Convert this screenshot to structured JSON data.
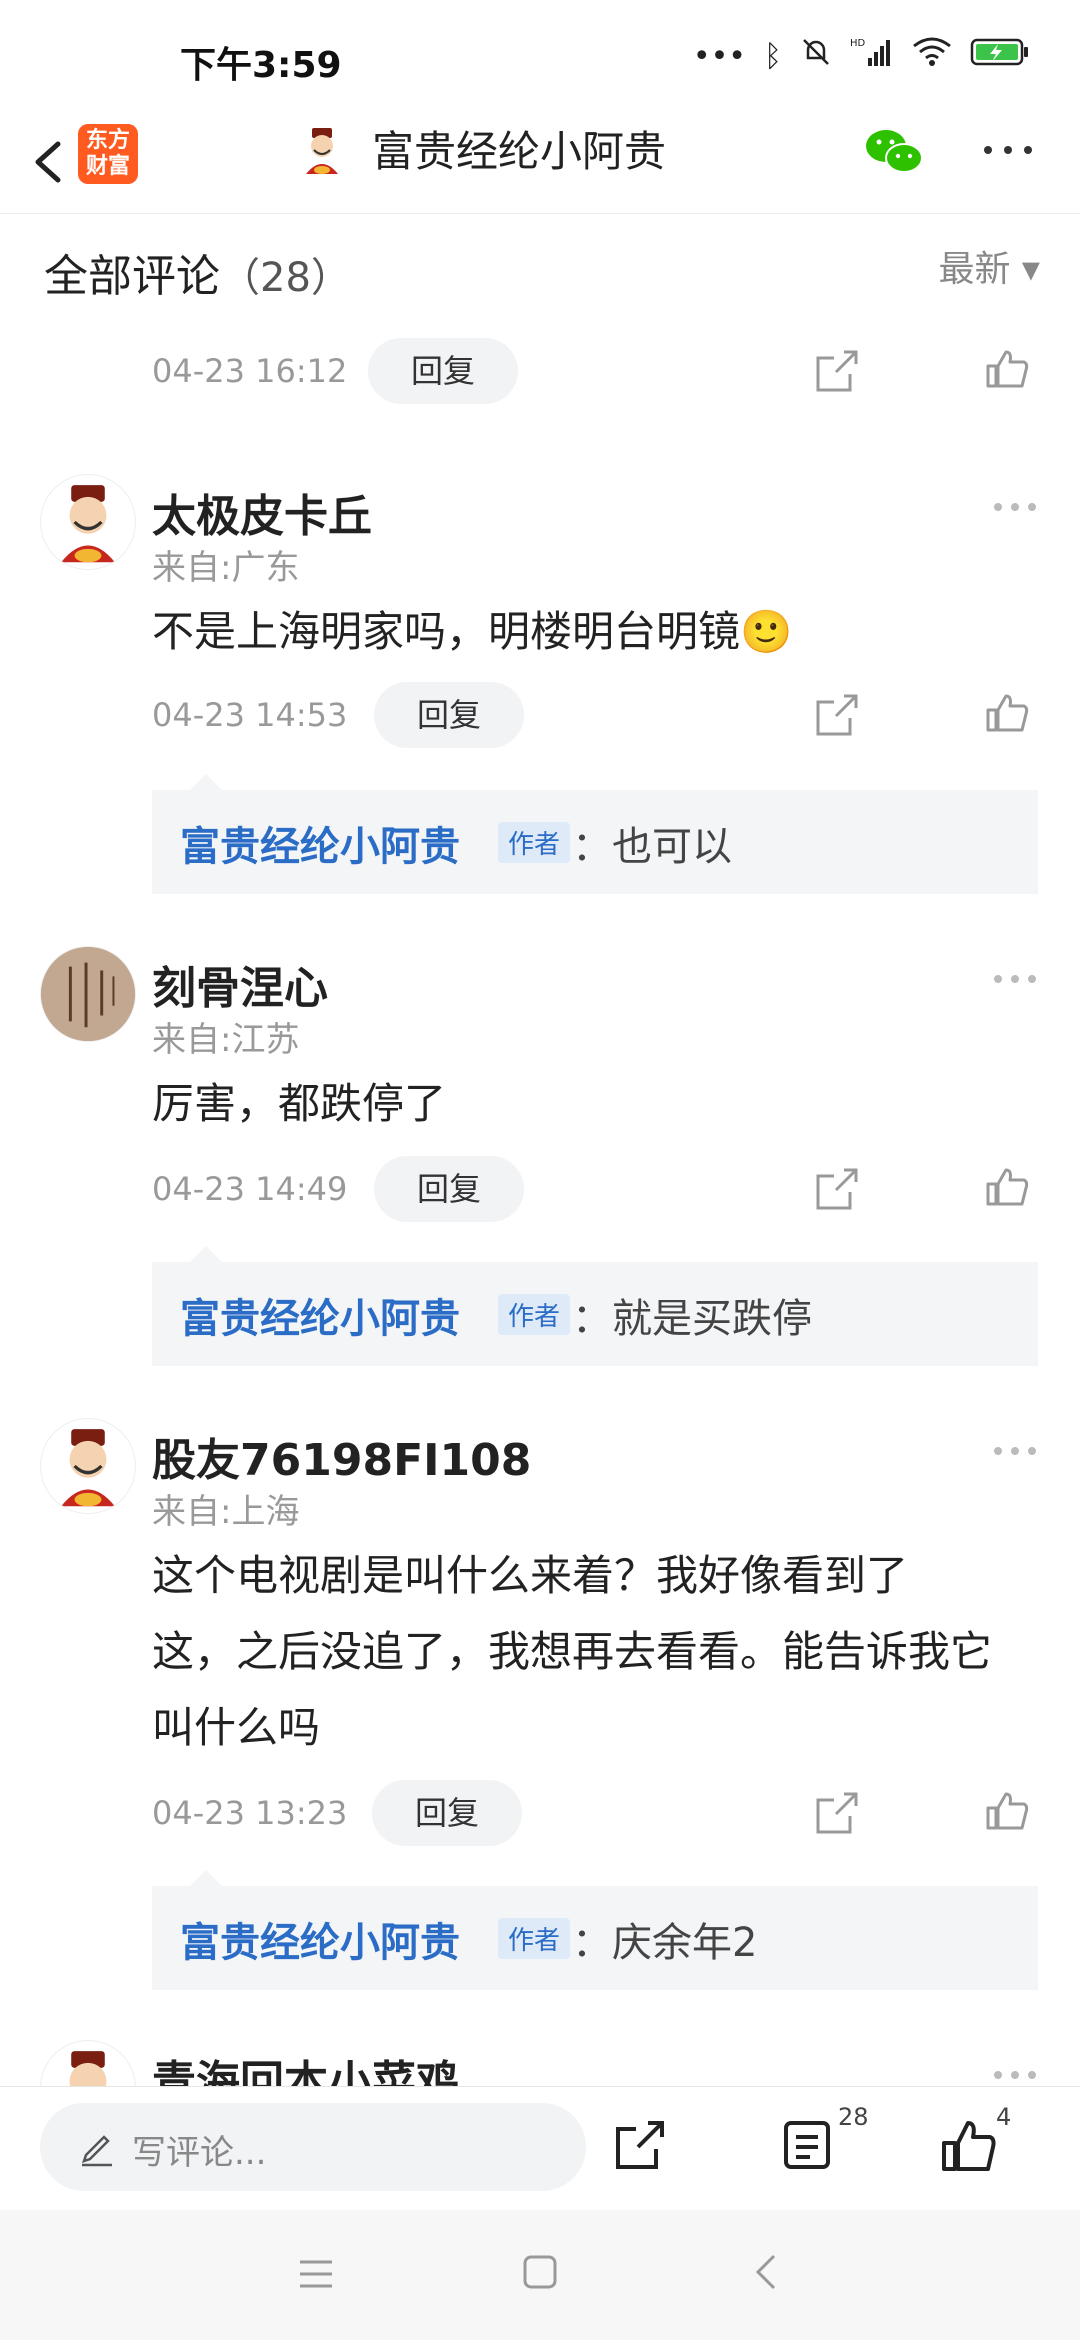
{
  "status_bar": {
    "time": "下午3:59",
    "icons": [
      "more-dots-icon",
      "bluetooth-icon",
      "mute-bell-icon",
      "hd-signal-icon",
      "wifi-icon",
      "battery-charging-icon"
    ]
  },
  "nav": {
    "logo_line1": "东方",
    "logo_line2": "财富",
    "title": "富贵经纶小阿贵"
  },
  "section": {
    "title": "全部评论",
    "count": "（28）",
    "sort_label": "最新 ▾"
  },
  "first_meta": {
    "time": "04-23 16:12",
    "reply": "回复"
  },
  "comments": [
    {
      "name": "太极皮卡丘",
      "location": "来自:广东",
      "text": "不是上海明家吗，明楼明台明镜🙂",
      "time": "04-23 14:53",
      "reply": "回复",
      "author_reply": {
        "author": "富贵经纶小阿贵",
        "badge": "作者",
        "text": "：也可以"
      }
    },
    {
      "name": "刻骨涅心",
      "location": "来自:江苏",
      "text": "厉害，都跌停了",
      "time": "04-23 14:49",
      "reply": "回复",
      "author_reply": {
        "author": "富贵经纶小阿贵",
        "badge": "作者",
        "text": "：就是买跌停"
      }
    },
    {
      "name": "股友76198FI108",
      "location": "来自:上海",
      "text_lines": [
        "这个电视剧是叫什么来着？我好像看到了",
        "这，之后没追了，我想再去看看。能告诉我它",
        "叫什么吗"
      ],
      "time": "04-23 13:23",
      "reply": "回复",
      "author_reply": {
        "author": "富贵经纶小阿贵",
        "badge": "作者",
        "text": "：庆余年2"
      }
    },
    {
      "name": "青海回本小菜鸡"
    }
  ],
  "bottom_bar": {
    "input_placeholder": "写评论...",
    "comment_count": "28",
    "like_count": "4"
  },
  "colors": {
    "accent_blue": "#2a6cc6",
    "brand_orange": "#ff5a1f",
    "wechat_green": "#2dc100"
  }
}
